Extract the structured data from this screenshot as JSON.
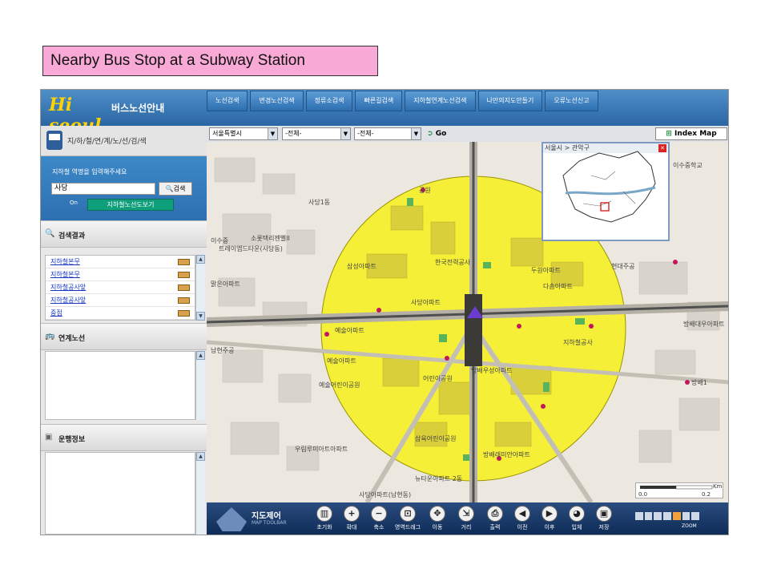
{
  "slide_title": "Nearby Bus Stop at a Subway Station",
  "app": {
    "logo": "Hi seoul",
    "logo_subtitle": "버스노선안내",
    "nav": [
      "노선검색",
      "변경노선검색",
      "정류소검색",
      "빠른길검색",
      "지하철연계노선검색",
      "나만의지도만들기",
      "오류노선신고"
    ]
  },
  "left_panel": {
    "title": "지/하/철/연/계/노/선/검/색",
    "search_label": "지하철 역명을 입력해주세요",
    "search_value": "사당",
    "search_button": "검색",
    "line_map_button": "지하철노선도보기",
    "toggle_label": "On",
    "results_title": "검색결과",
    "results": [
      "지하철본무",
      "지하철본무",
      "지하철공사앞",
      "지하철공사앞",
      "중점"
    ],
    "connected_title": "연계노선",
    "operation_title": "운행정보"
  },
  "map_toolbar": {
    "city": "서울특별시",
    "district": "-전체-",
    "dong": "-전체-",
    "go": "Go",
    "index_map": "Index Map"
  },
  "inset": {
    "title": "서울시 > 관악구"
  },
  "map_labels": [
    "공원",
    "사당1동",
    "삼성아파트",
    "한국전력공사",
    "두원아파트",
    "현대주공",
    "다솜아파트",
    "사당아파트",
    "방배대우아파트",
    "지하철공사",
    "예술아파트",
    "예술어린이공원",
    "어린이공원",
    "방배우성아파트",
    "예술아파트",
    "우림루미아트아파트",
    "삼육어린이공원",
    "방배래미안아파트",
    "뉴타운아파트 2동",
    "사당아파트(남현동)",
    "이수중학교",
    "소롯택리젠벨II",
    "트레이엠드타운(사당동)",
    "맑은아파트",
    "남현주공",
    "이수중",
    "방배1"
  ],
  "scale": {
    "unit": "Km",
    "min": "0.0",
    "max": "0.2"
  },
  "map_toolbar_bottom": {
    "title": "지도제어",
    "subtitle": "MAP TOOLBAR",
    "tools": [
      "초기화",
      "확대",
      "축소",
      "영역드래그",
      "이동",
      "거리",
      "출력",
      "이전",
      "이후",
      "입체",
      "저장"
    ],
    "zoom_label": "ZOOM"
  }
}
